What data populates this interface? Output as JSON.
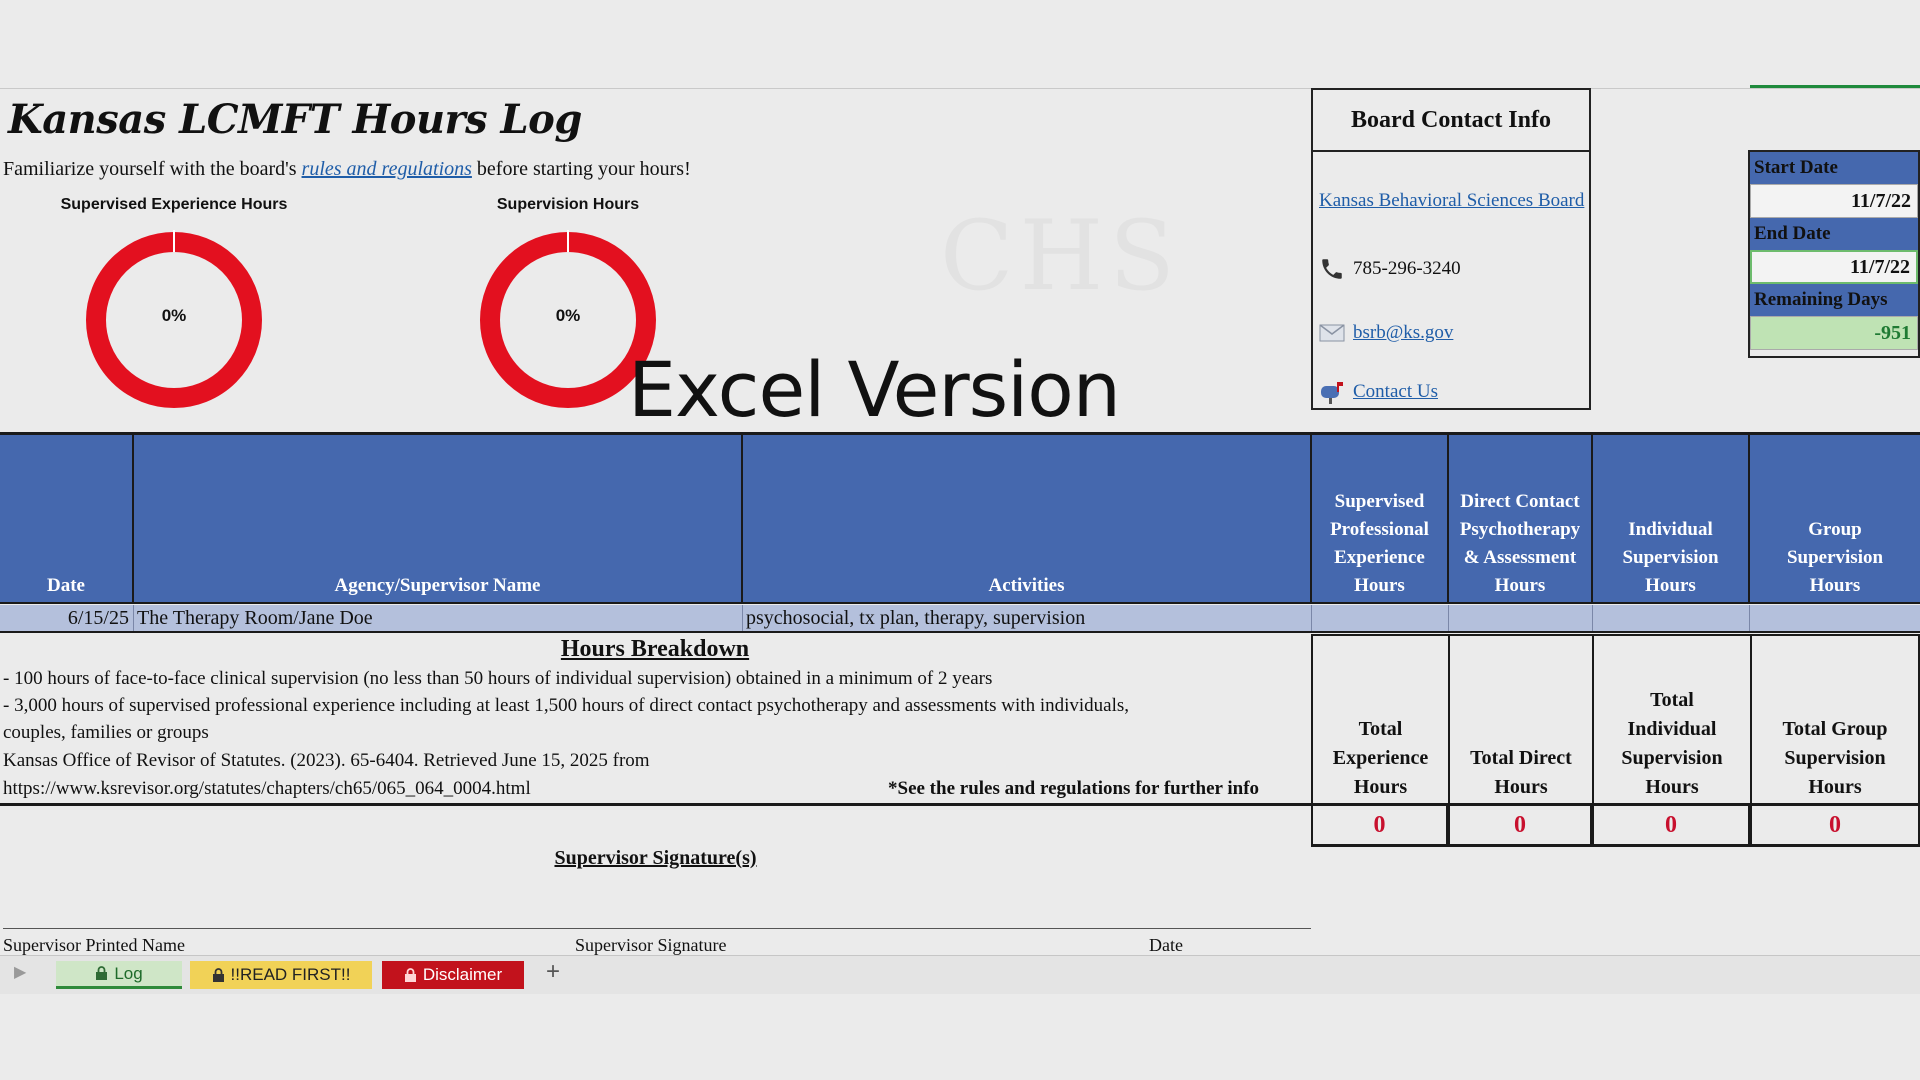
{
  "title": "Kansas LCMFT Hours Log",
  "intro": {
    "before": "Familiarize yourself with the board's ",
    "link": "rules and regulations",
    "after": " before starting your hours!"
  },
  "gauges": [
    {
      "label": "Supervised Experience Hours",
      "value_text": "0%",
      "progress": 0
    },
    {
      "label": "Supervision Hours",
      "value_text": "0%",
      "progress": 0
    }
  ],
  "watermark": "CHS",
  "overlay_caption": "Excel Version",
  "contact": {
    "heading": "Board Contact Info",
    "board_link": "Kansas Behavioral Sciences Board",
    "phone": "785-296-3240",
    "email": "bsrb@ks.gov",
    "contact_us": "Contact Us"
  },
  "dates": {
    "start_label": "Start Date",
    "start_value": "11/7/22",
    "end_label": "End Date",
    "end_value": "11/7/22",
    "remaining_label": "Remaining Days",
    "remaining_value": "-951"
  },
  "table": {
    "headers": [
      "Date",
      "Agency/Supervisor Name",
      "Activities",
      "Supervised Professional Experience Hours",
      "Direct Contact Psychotherapy & Assessment Hours",
      "Individual Supervision Hours",
      "Group Supervision Hours"
    ],
    "rows": [
      {
        "date": "6/15/25",
        "agency": "The Therapy Room/Jane Doe",
        "activities": "psychosocial, tx plan, therapy, supervision"
      }
    ]
  },
  "breakdown": {
    "title": "Hours Breakdown",
    "lines": [
      "- 100 hours of face-to-face clinical supervision (no less than 50 hours of individual supervision) obtained in a minimum of 2 years",
      "- 3,000 hours of supervised professional experience including at least 1,500 hours of direct contact psychotherapy and assessments with individuals,",
      "couples, families or groups",
      "Kansas Office of Revisor of Statutes. (2023). 65-6404. Retrieved June 15, 2025 from",
      "https://www.ksrevisor.org/statutes/chapters/ch65/065_064_0004.html"
    ],
    "note": "*See the rules and regulations for further info"
  },
  "totals": {
    "labels": [
      "Total Experience Hours",
      "Total Direct Hours",
      "Total Individual Supervision Hours",
      "Total Group Supervision Hours"
    ],
    "values": [
      "0",
      "0",
      "0",
      "0"
    ]
  },
  "signature": {
    "title": "Supervisor Signature(s)",
    "printed_name": "Supervisor Printed Name",
    "signature": "Supervisor Signature",
    "date": "Date"
  },
  "tabs": [
    {
      "label": "Log",
      "icon": "lock-icon"
    },
    {
      "label": "!!READ FIRST!!",
      "icon": "lock-icon"
    },
    {
      "label": "Disclaimer",
      "icon": "lock-icon"
    }
  ],
  "colors": {
    "header_blue": "#4568ae",
    "gauge_red": "#e3101f",
    "total_red": "#c8102e"
  }
}
